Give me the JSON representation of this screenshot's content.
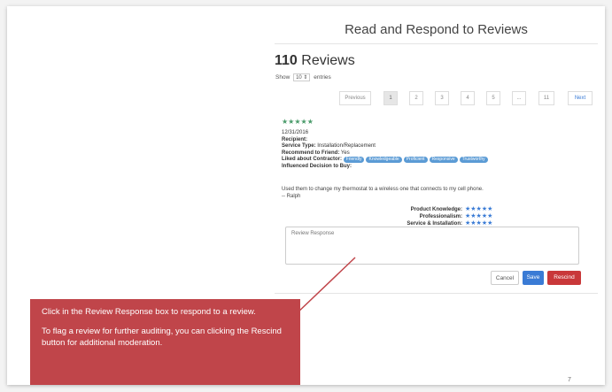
{
  "page": {
    "title": "Read and Respond to Reviews",
    "reviews_count_number": "110",
    "reviews_count_label": " Reviews",
    "show_label": "Show",
    "entries_value": "10",
    "entries_label": "entries"
  },
  "pagination": {
    "previous": "Previous",
    "pages": [
      "1",
      "2",
      "3",
      "4",
      "5",
      "...",
      "11"
    ],
    "next": "Next"
  },
  "review": {
    "stars": "★★★★★",
    "date": "12/31/2016",
    "recipient_label": "Recipient:",
    "service_type_label": "Service Type:",
    "service_type_value": "Installation/Replacement",
    "recommend_label": "Recommend to Friend:",
    "recommend_value": "Yes",
    "liked_label": "Liked about Contractor:",
    "liked_tags": [
      "Friendly",
      "Knowledgeable",
      "Proficient",
      "Responsive",
      "Trustworthy"
    ],
    "influenced_label": "Influenced Decision to Buy:",
    "text": "Used them to change my thermostat to a wireless one that connects to my cell phone.",
    "author": "-- Ralph",
    "ratings": [
      {
        "label": "Product Knowledge:",
        "stars": "★★★★★"
      },
      {
        "label": "Professionalism:",
        "stars": "★★★★★"
      },
      {
        "label": "Service & Installation:",
        "stars": "★★★★★"
      }
    ]
  },
  "response": {
    "placeholder": "Review Response",
    "cancel_label": "Cancel",
    "save_label": "Save",
    "rescind_label": "Rescind"
  },
  "callout": {
    "line1": "Click in the Review Response box to respond to a review.",
    "line2": "To flag a review for further auditing, you can clicking the Rescind button for additional moderation."
  },
  "slide_number": "7",
  "colors": {
    "save": "#3a7bd5",
    "rescind": "#c9383a",
    "callout": "#c0454a",
    "star_green": "#4a9b6a",
    "tag_blue": "#5b9bd5"
  }
}
